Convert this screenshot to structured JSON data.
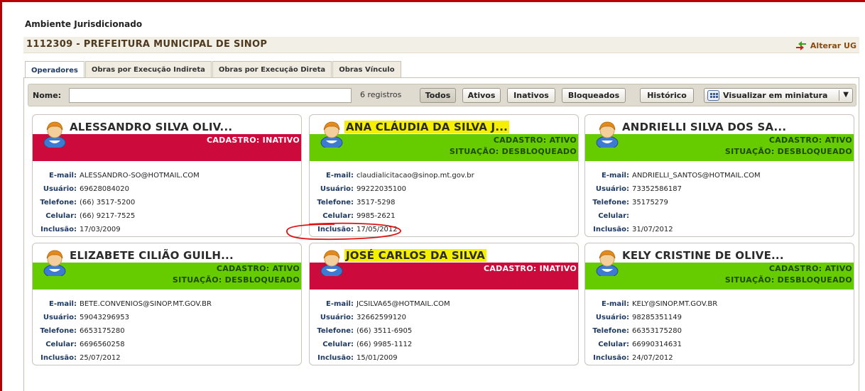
{
  "environment": {
    "title": "Ambiente Jurisdicionado"
  },
  "ug": {
    "title": "1112309 - PREFEITURA MUNICIPAL DE SINOP",
    "change_label": "Alterar UG"
  },
  "tabs": [
    {
      "label": "Operadores",
      "active": true
    },
    {
      "label": "Obras por Execução Indireta",
      "active": false
    },
    {
      "label": "Obras por Execução Direta",
      "active": false
    },
    {
      "label": "Obras Vínculo",
      "active": false
    }
  ],
  "toolbar": {
    "name_label": "Nome:",
    "name_value": "",
    "count": "6 registros",
    "filters": [
      "Todos",
      "Ativos",
      "Inativos",
      "Bloqueados"
    ],
    "active_filter": "Todos",
    "history": "Histórico",
    "view": "Visualizar em miniatura"
  },
  "field_labels": {
    "email": "E-mail:",
    "usuario": "Usuário:",
    "telefone": "Telefone:",
    "celular": "Celular:",
    "inclusao": "Inclusão:"
  },
  "operators": [
    {
      "name": "ALESSANDRO SILVA OLIV...",
      "highlighted": false,
      "status": "inativo",
      "cadastro": "CADASTRO: INATIVO",
      "situacao": "",
      "email": "ALESSANDRO-SO@HOTMAIL.COM",
      "usuario": "69628084020",
      "telefone": "(66) 3517-5200",
      "celular": "(66) 9217-7525",
      "inclusao": "17/03/2009"
    },
    {
      "name": "ANA CLÁUDIA DA SILVA J...",
      "highlighted": true,
      "status": "ativo",
      "cadastro": "CADASTRO: ATIVO",
      "situacao": "SITUAÇÃO: DESBLOQUEADO",
      "email": "claudialicitacao@sinop.mt.gov.br",
      "usuario": "99222035100",
      "telefone": "3517-5298",
      "celular": "9985-2621",
      "inclusao": "17/05/2012"
    },
    {
      "name": "ANDRIELLI SILVA DOS SA...",
      "highlighted": false,
      "status": "ativo",
      "cadastro": "CADASTRO: ATIVO",
      "situacao": "SITUAÇÃO: DESBLOQUEADO",
      "email": "ANDRIELLI_SANTOS@HOTMAIL.COM",
      "usuario": "73352586187",
      "telefone": "35175279",
      "celular": "",
      "inclusao": "31/07/2012"
    },
    {
      "name": "ELIZABETE CILIÃO GUILH...",
      "highlighted": false,
      "status": "ativo",
      "cadastro": "CADASTRO: ATIVO",
      "situacao": "SITUAÇÃO: DESBLOQUEADO",
      "email": "BETE.CONVENIOS@SINOP.MT.GOV.BR",
      "usuario": "59043296953",
      "telefone": "6653175280",
      "celular": "6696560258",
      "inclusao": "25/07/2012"
    },
    {
      "name": "JOSÉ CARLOS DA SILVA",
      "highlighted": true,
      "status": "inativo",
      "cadastro": "CADASTRO: INATIVO",
      "situacao": "",
      "email": "JCSILVA65@HOTMAIL.COM",
      "usuario": "32662599120",
      "telefone": "(66) 3511-6905",
      "celular": "(66) 9985-1112",
      "inclusao": "15/01/2009"
    },
    {
      "name": "KELY CRISTINE DE OLIVE...",
      "highlighted": false,
      "status": "ativo",
      "cadastro": "CADASTRO: ATIVO",
      "situacao": "SITUAÇÃO: DESBLOQUEADO",
      "email": "KELY@SINOP.MT.GOV.BR",
      "usuario": "98285351149",
      "telefone": "66353175280",
      "celular": "66990314631",
      "inclusao": "24/07/2012"
    }
  ],
  "colors": {
    "ativo": "#66cc00",
    "inativo": "#cc0a3b",
    "highlight": "#f5f000",
    "annotation": "#e01010",
    "frame": "#b80000"
  }
}
